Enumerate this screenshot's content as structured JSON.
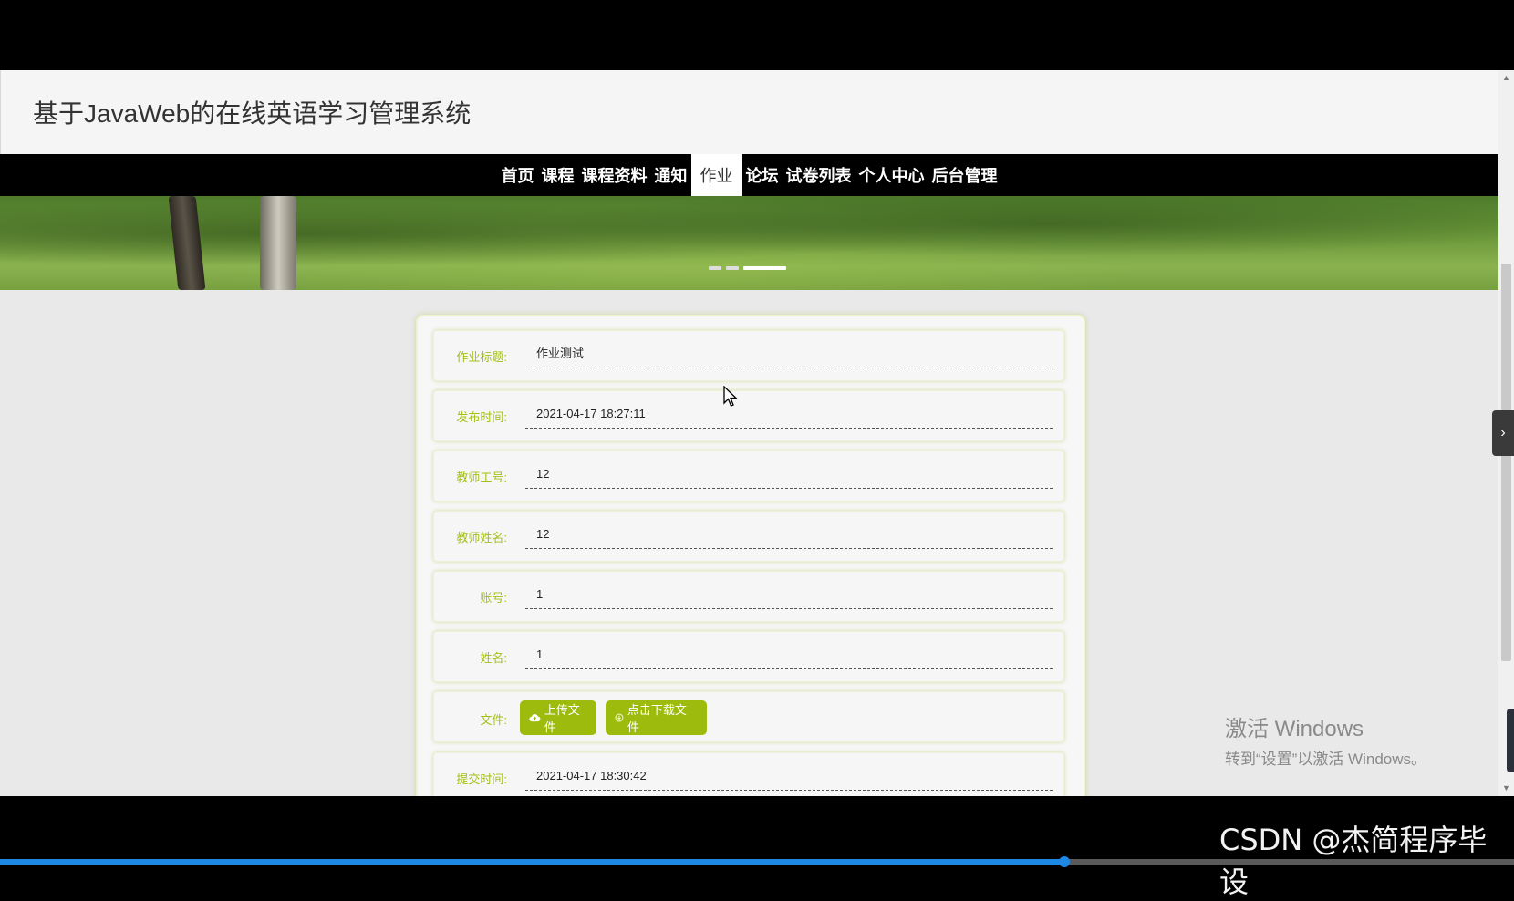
{
  "site": {
    "title": "基于JavaWeb的在线英语学习管理系统"
  },
  "nav": {
    "items": [
      {
        "label": "首页"
      },
      {
        "label": "课程"
      },
      {
        "label": "课程资料"
      },
      {
        "label": "通知"
      },
      {
        "label": "作业"
      },
      {
        "label": "论坛"
      },
      {
        "label": "试卷列表"
      },
      {
        "label": "个人中心"
      },
      {
        "label": "后台管理"
      }
    ],
    "active_index": 4
  },
  "detail": {
    "fields": [
      {
        "label": "作业标题:",
        "value": "作业测试"
      },
      {
        "label": "发布时间:",
        "value": "2021-04-17 18:27:11"
      },
      {
        "label": "教师工号:",
        "value": "12"
      },
      {
        "label": "教师姓名:",
        "value": "12"
      },
      {
        "label": "账号:",
        "value": "1"
      },
      {
        "label": "姓名:",
        "value": "1"
      }
    ],
    "file": {
      "label": "文件:",
      "upload_label": "上传文件",
      "download_label": "点击下载文件"
    },
    "submit_time": {
      "label": "提交时间:",
      "value": "2021-04-17 18:30:42"
    }
  },
  "windows_activation": {
    "line1": "激活 Windows",
    "line2": "转到“设置”以激活 Windows。"
  },
  "watermark": "CSDN @杰简程序毕设",
  "video_progress": 0.703,
  "colors": {
    "accent_green": "#9cbb0c",
    "label_green": "#a5bf17",
    "nav_bg": "#000000",
    "progress_blue": "#1e88e5"
  }
}
